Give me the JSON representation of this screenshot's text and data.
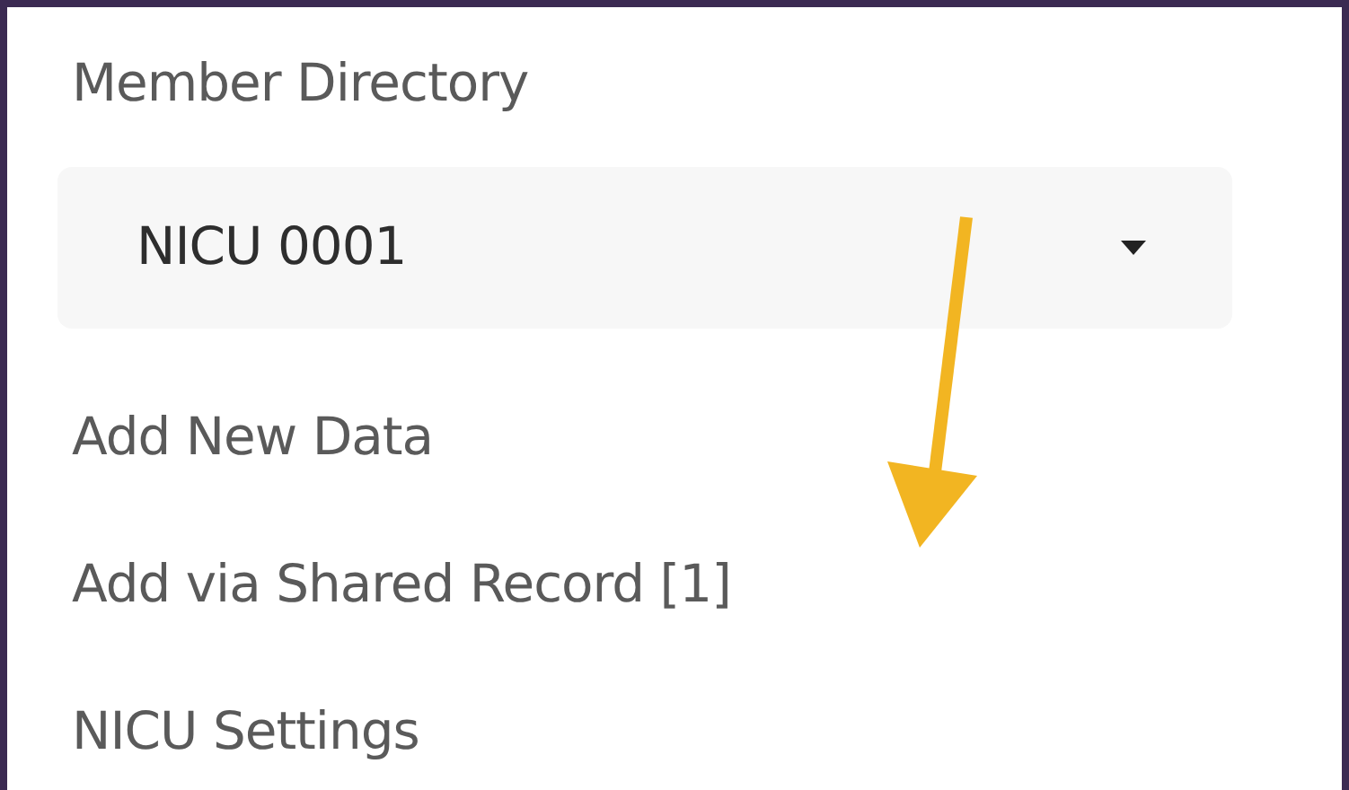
{
  "panel": {
    "title": "Member Directory",
    "select": {
      "value": "NICU 0001"
    },
    "menu_items": [
      {
        "label": "Add New Data"
      },
      {
        "label": "Add via Shared Record [1]"
      },
      {
        "label": "NICU Settings"
      }
    ]
  }
}
